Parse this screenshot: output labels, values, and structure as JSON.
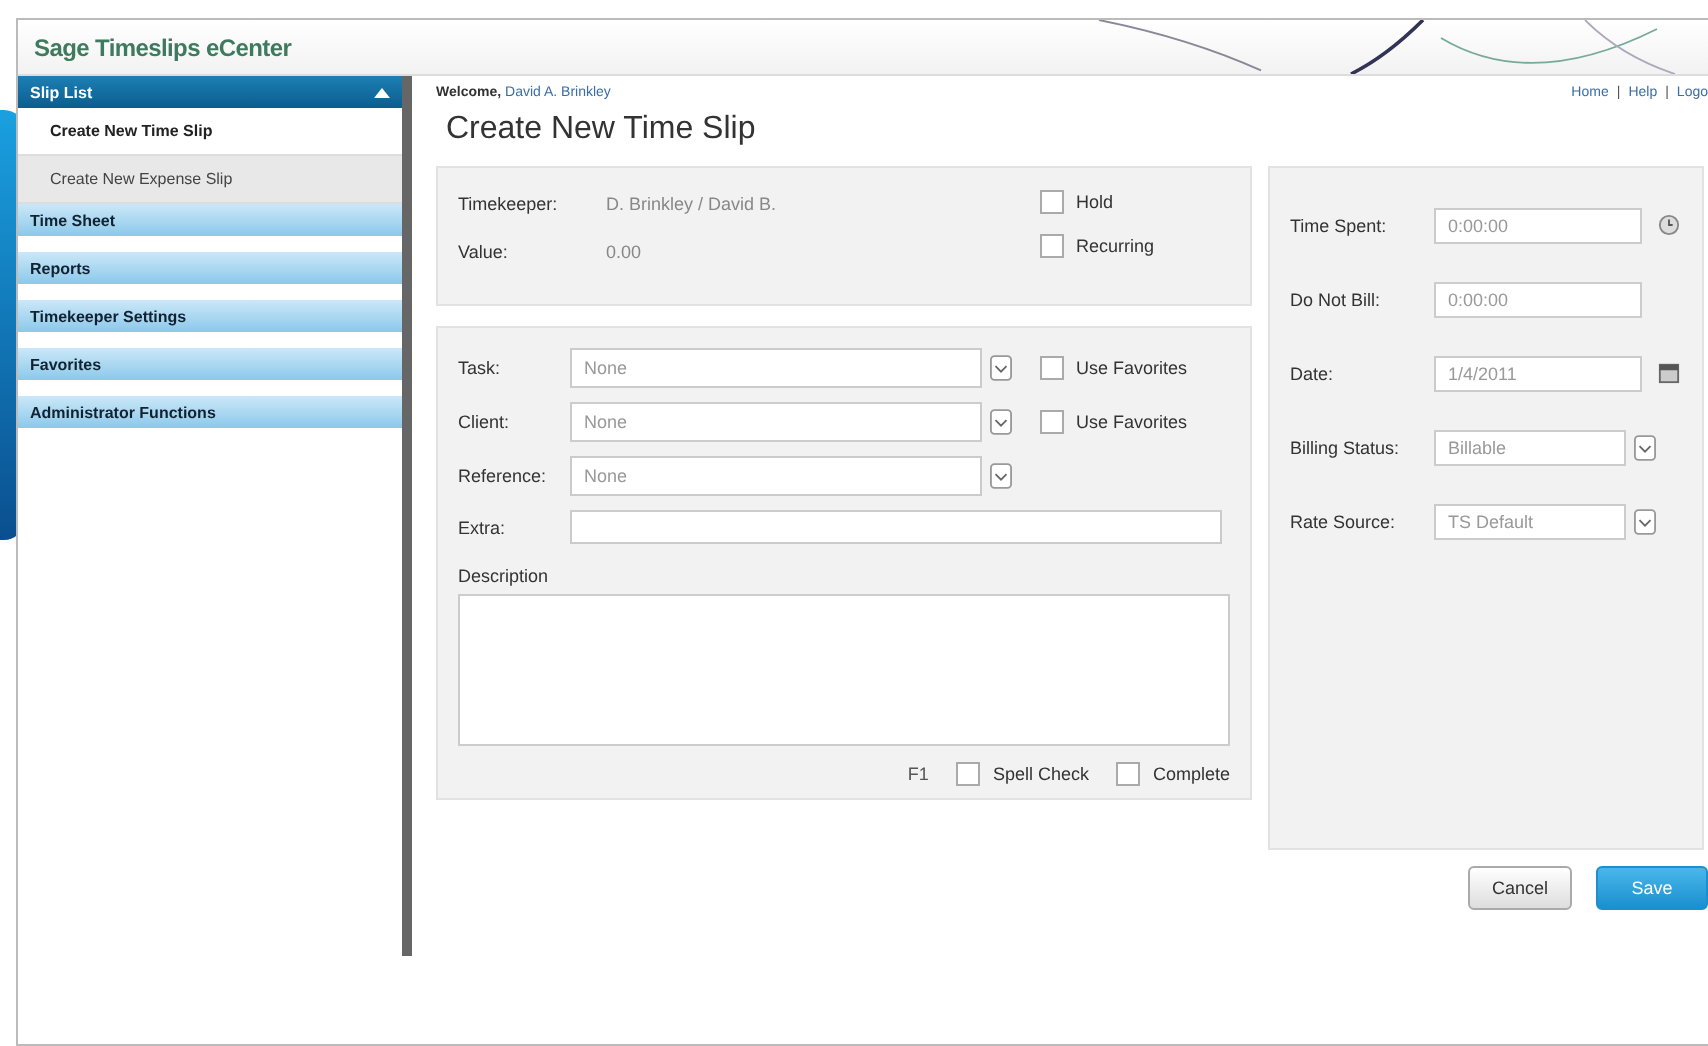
{
  "header": {
    "title": "Sage Timeslips eCenter"
  },
  "sidebar": {
    "sections": [
      {
        "label": "Slip List",
        "expanded": true,
        "items": [
          {
            "label": "Create New Time Slip",
            "selected": true
          },
          {
            "label": "Create New Expense Slip",
            "selected": false
          }
        ]
      },
      {
        "label": "Time Sheet",
        "expanded": false
      },
      {
        "label": "Reports",
        "expanded": false
      },
      {
        "label": "Timekeeper Settings",
        "expanded": false
      },
      {
        "label": "Favorites",
        "expanded": false
      },
      {
        "label": "Administrator Functions",
        "expanded": false
      }
    ]
  },
  "welcome": {
    "label": "Welcome,",
    "name": "David A. Brinkley"
  },
  "top_links": [
    {
      "label": "Home"
    },
    {
      "label": "Help"
    },
    {
      "label": "Logo"
    }
  ],
  "link_separator": "|",
  "page_title": "Create New Time Slip",
  "info": {
    "rows": [
      {
        "label": "Timekeeper:",
        "value": "D. Brinkley / David B."
      },
      {
        "label": "Value:",
        "value": "0.00"
      }
    ],
    "checkboxes": [
      {
        "label": "Hold",
        "checked": false
      },
      {
        "label": "Recurring",
        "checked": false
      }
    ]
  },
  "form": {
    "selects": [
      {
        "label": "Task:",
        "value": "None",
        "favorites": {
          "label": "Use Favorites",
          "checked": false
        }
      },
      {
        "label": "Client:",
        "value": "None",
        "favorites": {
          "label": "Use Favorites",
          "checked": false
        }
      },
      {
        "label": "Reference:",
        "value": "None"
      }
    ],
    "extra": {
      "label": "Extra:"
    },
    "description": {
      "label": "Description"
    },
    "footer": {
      "hint": "F1",
      "checkboxes": [
        {
          "label": "Spell Check",
          "checked": false
        },
        {
          "label": "Complete",
          "checked": false
        }
      ]
    }
  },
  "side_fields": [
    {
      "kind": "time",
      "label": "Time Spent:",
      "value": "0:00:00"
    },
    {
      "kind": "text",
      "label": "Do Not Bill:",
      "value": "0:00:00"
    },
    {
      "kind": "date",
      "label": "Date:",
      "value": "1/4/2011"
    },
    {
      "kind": "select",
      "label": "Billing Status:",
      "value": "Billable"
    },
    {
      "kind": "select",
      "label": "Rate Source:",
      "value": "TS Default"
    }
  ],
  "buttons": [
    {
      "label": "Cancel",
      "kind": "secondary"
    },
    {
      "label": "Save",
      "kind": "primary"
    }
  ]
}
